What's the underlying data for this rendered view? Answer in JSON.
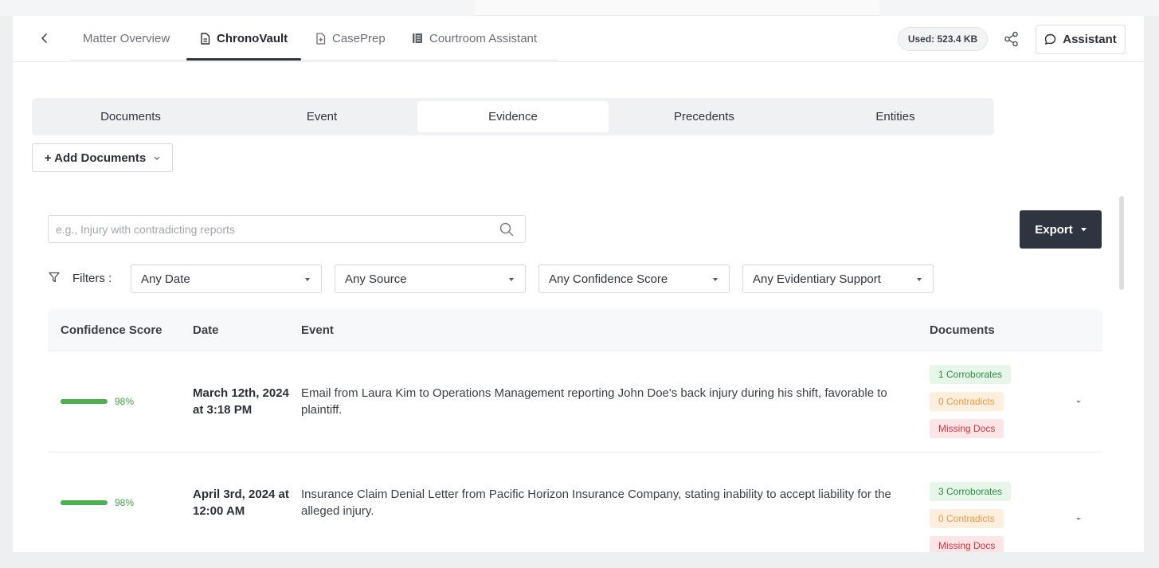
{
  "header": {
    "nav_tabs": [
      {
        "label": "Matter Overview"
      },
      {
        "label": "ChronoVault"
      },
      {
        "label": "CasePrep"
      },
      {
        "label": "Courtroom Assistant"
      }
    ],
    "used": "Used: 523.4 KB",
    "assistant_label": "Assistant"
  },
  "subtabs": [
    {
      "label": "Documents"
    },
    {
      "label": "Event"
    },
    {
      "label": "Evidence",
      "active": true
    },
    {
      "label": "Precedents"
    },
    {
      "label": "Entities"
    }
  ],
  "add_documents_label": "+ Add Documents",
  "search": {
    "placeholder": "e.g., Injury with contradicting reports",
    "value": ""
  },
  "export_label": "Export",
  "filters": {
    "label": "Filters :",
    "selects": [
      {
        "value": "Any Date"
      },
      {
        "value": "Any Source"
      },
      {
        "value": "Any Confidence Score"
      },
      {
        "value": "Any Evidentiary Support"
      }
    ]
  },
  "table": {
    "columns": [
      "Confidence Score",
      "Date",
      "Event",
      "Documents"
    ],
    "rows": [
      {
        "confidence_percent": 98,
        "confidence": "98%",
        "date_line1": "March 12th, 2024",
        "date_line2": "at 3:18 PM",
        "event": "Email from Laura Kim to Operations Management reporting John Doe's back injury during his shift, favorable to plaintiff.",
        "corroborates": "1 Corroborates",
        "contradicts": "0 Contradicts",
        "missing": "Missing Docs"
      },
      {
        "confidence_percent": 98,
        "confidence": "98%",
        "date_line1": "April 3rd, 2024 at",
        "date_line2": "12:00 AM",
        "event": "Insurance Claim Denial Letter from Pacific Horizon Insurance Company, stating inability to accept liability for the alleged injury.",
        "corroborates": "3 Corroborates",
        "contradicts": "0 Contradicts",
        "missing": "Missing Docs"
      }
    ]
  },
  "colors": {
    "accent_dark": "#2f3540",
    "confidence_green": "#4caf50",
    "corroborates": "#2e8b43",
    "contradicts": "#f09a45",
    "missing": "#d8363d"
  }
}
